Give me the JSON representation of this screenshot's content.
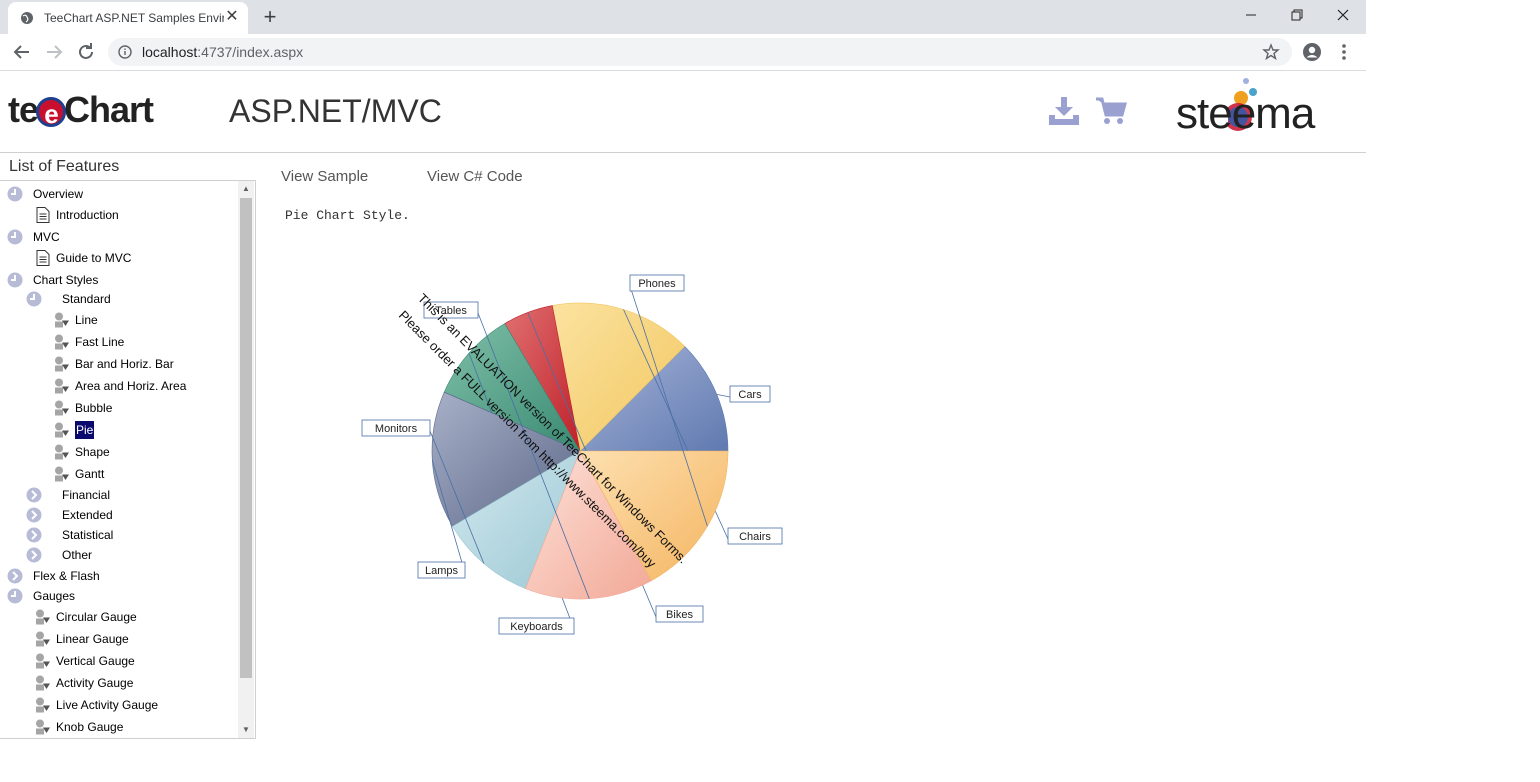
{
  "browser": {
    "tab_title": "TeeChart ASP.NET Samples Enviro",
    "url_host": "localhost",
    "url_rest": ":4737/index.aspx"
  },
  "header": {
    "logo_pre": "te",
    "logo_ee": "e",
    "logo_post": "Chart",
    "platform": "ASP.NET/MVC",
    "brand": "steema"
  },
  "sidebar": {
    "title": "List of Features",
    "items": [
      {
        "label": "Overview",
        "icon": "group-collapse-icon"
      },
      {
        "label": "Introduction",
        "icon": "document-icon"
      },
      {
        "label": "MVC",
        "icon": "group-collapse-icon"
      },
      {
        "label": "Guide to MVC",
        "icon": "document-icon"
      },
      {
        "label": "Chart Styles",
        "icon": "group-collapse-icon"
      },
      {
        "label": "Standard",
        "icon": "group-collapse-icon"
      },
      {
        "label": "Line",
        "icon": "sample-icon"
      },
      {
        "label": "Fast Line",
        "icon": "sample-icon"
      },
      {
        "label": "Bar and Horiz. Bar",
        "icon": "sample-icon"
      },
      {
        "label": "Area and Horiz. Area",
        "icon": "sample-icon"
      },
      {
        "label": "Bubble",
        "icon": "sample-icon"
      },
      {
        "label": "Pie",
        "icon": "sample-icon",
        "selected": true
      },
      {
        "label": "Shape",
        "icon": "sample-icon"
      },
      {
        "label": "Gantt",
        "icon": "sample-icon"
      },
      {
        "label": "Financial",
        "icon": "group-expand-icon"
      },
      {
        "label": "Extended",
        "icon": "group-expand-icon"
      },
      {
        "label": "Statistical",
        "icon": "group-expand-icon"
      },
      {
        "label": "Other",
        "icon": "group-expand-icon"
      },
      {
        "label": "Flex & Flash",
        "icon": "group-expand-icon"
      },
      {
        "label": "Gauges",
        "icon": "group-collapse-icon"
      },
      {
        "label": "Circular Gauge",
        "icon": "sample-icon"
      },
      {
        "label": "Linear Gauge",
        "icon": "sample-icon"
      },
      {
        "label": "Vertical Gauge",
        "icon": "sample-icon"
      },
      {
        "label": "Activity Gauge",
        "icon": "sample-icon"
      },
      {
        "label": "Live Activity Gauge",
        "icon": "sample-icon"
      },
      {
        "label": "Knob Gauge",
        "icon": "sample-icon"
      }
    ]
  },
  "content": {
    "tab_view_sample": "View Sample",
    "tab_view_code": "View C# Code",
    "description": "Pie Chart Style."
  },
  "chart_data": {
    "type": "pie",
    "categories": [
      "Cars",
      "Chairs",
      "Bikes",
      "Keyboards",
      "Lamps",
      "Monitors",
      "Tables",
      "Phones"
    ],
    "values": [
      12.5,
      15.5,
      5.5,
      10,
      15,
      10.5,
      14,
      17
    ],
    "watermark_line1": "This is an EVALUATION version of TeeChart for Windows Forms.",
    "watermark_line2": "Please order a FULL version from http://www.steema.com/buy"
  },
  "colors": {
    "accent": "#9aa0d0",
    "selection": "#0a0a6e"
  }
}
